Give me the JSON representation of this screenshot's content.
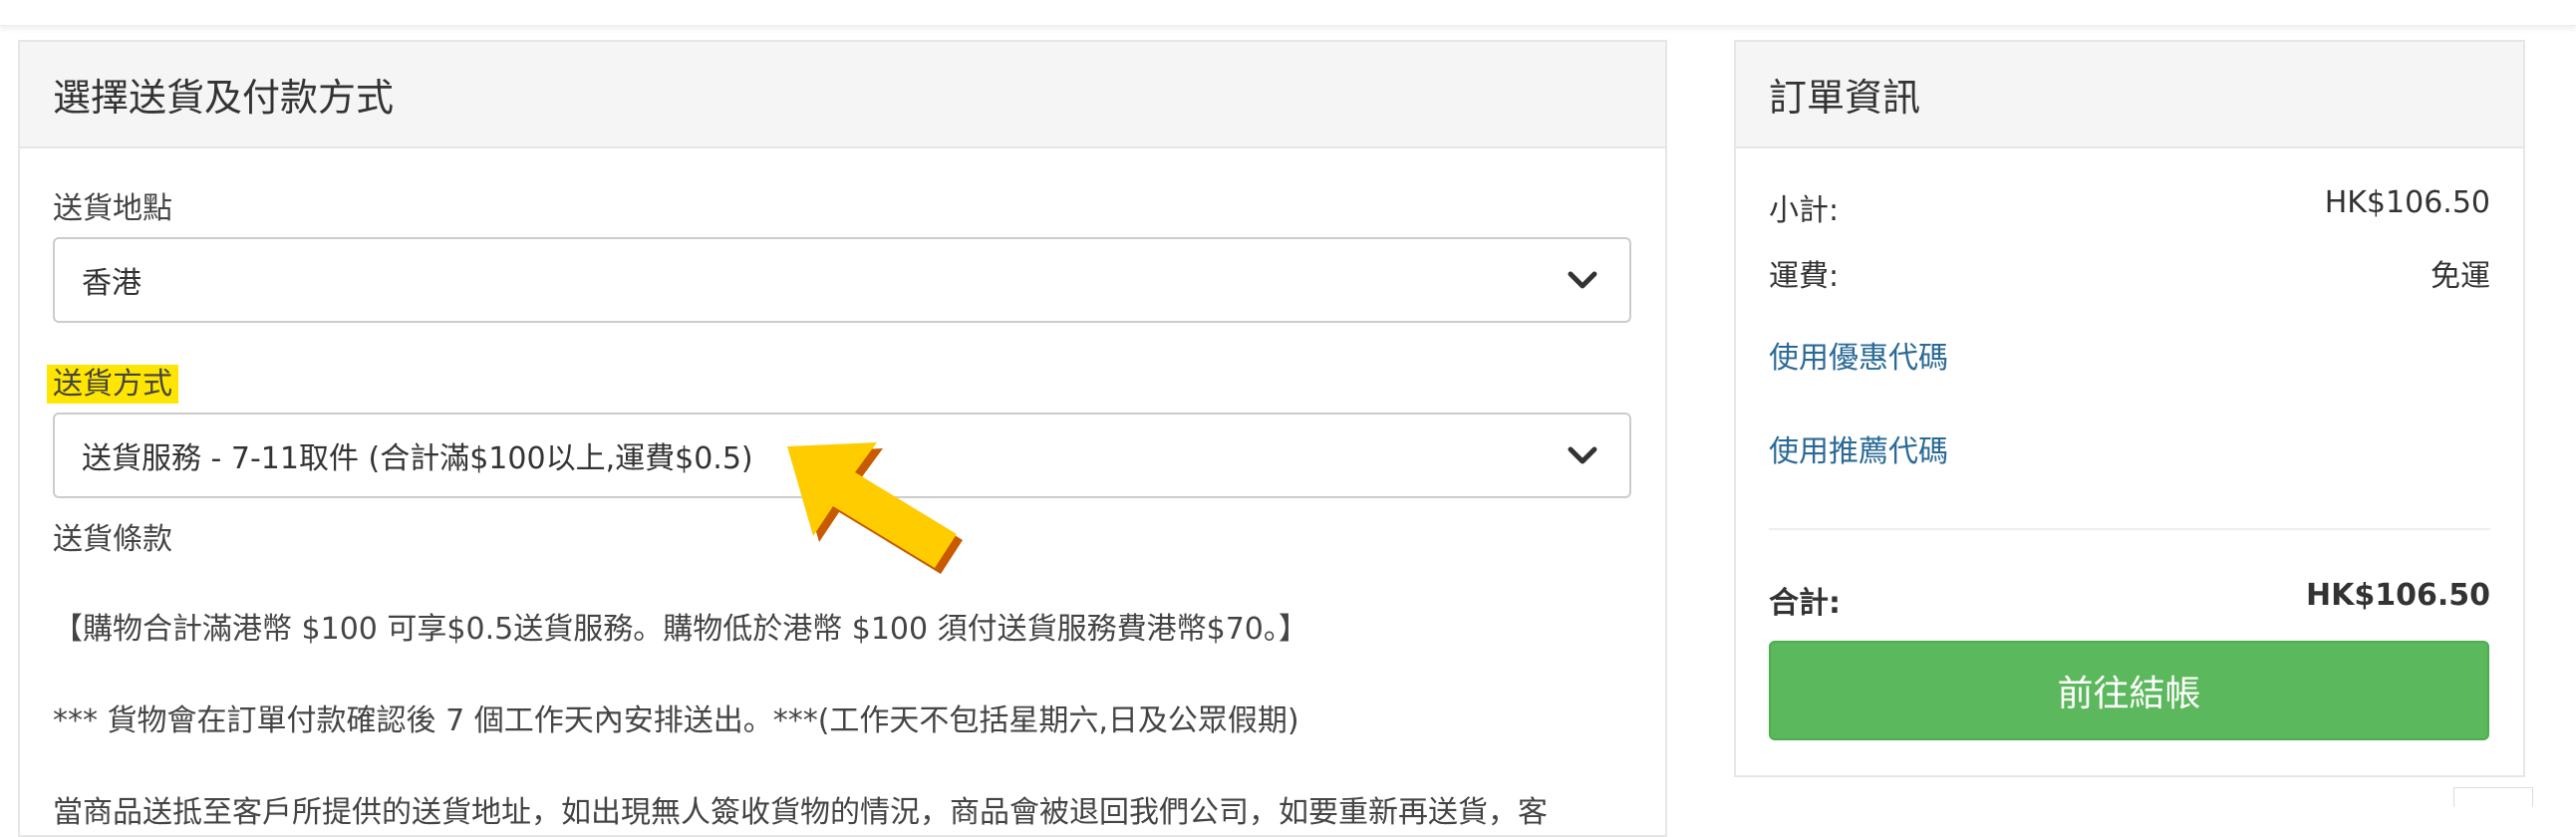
{
  "shipping_panel": {
    "title": "選擇送貨及付款方式",
    "location_label": "送貨地點",
    "location_value": "香港",
    "method_label": "送貨方式",
    "method_value": "送貨服務 - 7-11取件 (合計滿$100以上,運費$0.5)",
    "terms_label": "送貨條款",
    "terms_lines": [
      "【購物合計滿港幣 $100 可享$0.5送貨服務。購物低於港幣 $100 須付送貨服務費港幣$70。】",
      "*** 貨物會在訂單付款確認後 7 個工作天內安排送出。***(工作天不包括星期六,日及公眾假期)",
      "當商品送抵至客戶所提供的送貨地址，如出現無人簽收貨物的情況，商品會被退回我們公司，如要重新再送貨，客"
    ]
  },
  "order_panel": {
    "title": "訂單資訊",
    "subtotal_label": "小計:",
    "subtotal_value": "HK$106.50",
    "shipping_label": "運費:",
    "shipping_value": "免運",
    "coupon_link": "使用優惠代碼",
    "referral_link": "使用推薦代碼",
    "total_label": "合計:",
    "total_value": "HK$106.50",
    "checkout_button": "前往結帳"
  },
  "annotation": {
    "highlight_color": "#ffe600",
    "arrow_color": "#ffcc00",
    "arrow_icon": "pointer-arrow-icon"
  }
}
